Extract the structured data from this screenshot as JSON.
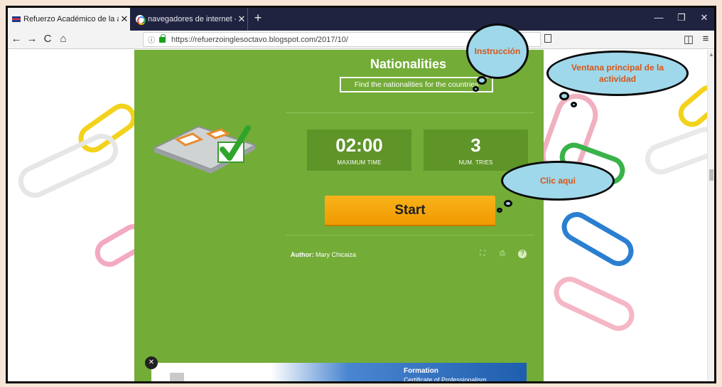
{
  "browser": {
    "tabs": [
      {
        "label": "Refuerzo Académico de la asig",
        "active": true
      },
      {
        "label": "navegadores de internet - Busc",
        "active": false
      }
    ],
    "new_tab": "+",
    "close_glyph": "✕",
    "window_controls": {
      "minimize": "—",
      "restore": "❐",
      "close": "✕"
    },
    "nav": {
      "back": "←",
      "forward": "→",
      "reload": "C",
      "home": "⌂"
    },
    "address": {
      "info_glyph": "ⓘ",
      "url": "https://refuerzoinglesoctavo.blogspot.com/2017/10/"
    },
    "menu": "≡",
    "sidebar_glyph": "◫"
  },
  "activity": {
    "title": "Nationalities",
    "instruction": "Find the nationalities for the countries",
    "time_value": "02:00",
    "time_label": "MAXIMUM TIME",
    "tries_value": "3",
    "tries_label": "NUM. TRIES",
    "start_label": "Start",
    "author_label": "Author:",
    "author_name": "Mary Chicaiza",
    "footer_icons": [
      "fullscreen-icon",
      "print-icon",
      "help-icon"
    ],
    "help_glyph": "?",
    "fullscreen_glyph": "⛶",
    "print_glyph": "⎙"
  },
  "ad": {
    "close_glyph": "✕",
    "line1": "Formation",
    "line2": "Certificate of Professionalism"
  },
  "callouts": {
    "instruction": "Instrucción",
    "main_window": "Ventana principal de la actividad",
    "click_here": "Clic aqui"
  },
  "colors": {
    "panel_green": "#73ac37",
    "stat_green": "#5e9428",
    "start_orange": "#f4a20c",
    "bubble_blue": "#9fd8ea",
    "callout_text": "#d4561a"
  }
}
